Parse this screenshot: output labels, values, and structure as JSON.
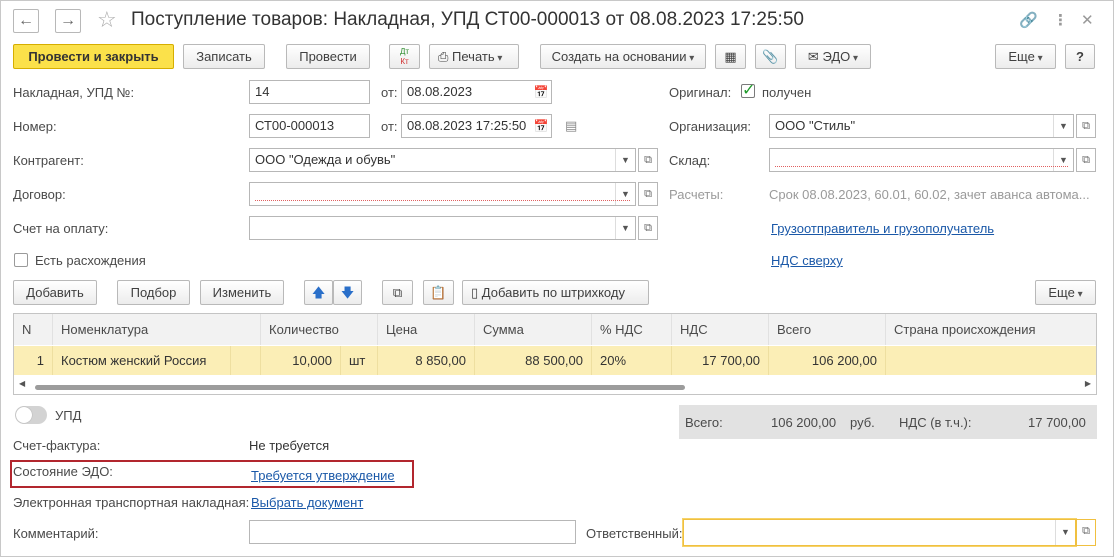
{
  "window": {
    "title": "Поступление товаров: Накладная, УПД СТ00-000013 от 08.08.2023 17:25:50"
  },
  "toolbar": {
    "post_close": "Провести и закрыть",
    "save": "Записать",
    "post": "Провести",
    "dtkt_dt": "Дт",
    "dtkt_kt": "Кт",
    "print": "Печать",
    "create_based": "Создать на основании",
    "edo": "ЭДО",
    "more": "Еще",
    "help": "?"
  },
  "form": {
    "invoice_label": "Накладная, УПД №:",
    "invoice_value": "14",
    "from_label": "от:",
    "invoice_date": "08.08.2023",
    "number_label": "Номер:",
    "number_value": "СТ00-000013",
    "number_date": "08.08.2023 17:25:50",
    "counterparty_label": "Контрагент:",
    "counterparty_value": "ООО \"Одежда и обувь\"",
    "contract_label": "Договор:",
    "contract_value": "",
    "payment_label": "Счет на оплату:",
    "payment_value": "",
    "discrepancies_label": "Есть расхождения",
    "original_label": "Оригинал:",
    "original_value": "получен",
    "org_label": "Организация:",
    "org_value": "ООО \"Стиль\"",
    "warehouse_label": "Склад:",
    "warehouse_value": "",
    "settlements_label": "Расчеты:",
    "settlements_value": "Срок 08.08.2023, 60.01, 60.02, зачет аванса автома...",
    "shipper_link": "Грузоотправитель и грузополучатель",
    "vat_link": "НДС сверху"
  },
  "table_toolbar": {
    "add": "Добавить",
    "pick": "Подбор",
    "change": "Изменить",
    "barcode": "Добавить по штрихкоду",
    "more": "Еще"
  },
  "table": {
    "headers": [
      "N",
      "Номенклатура",
      "Количество",
      "Цена",
      "Сумма",
      "% НДС",
      "НДС",
      "Всего",
      "Страна происхождения"
    ],
    "rows": [
      {
        "n": "1",
        "item": "Костюм женский Россия",
        "qty": "10,000",
        "unit": "шт",
        "price": "8 850,00",
        "sum": "88 500,00",
        "vat_rate": "20%",
        "vat": "17 700,00",
        "total": "106 200,00",
        "country": ""
      }
    ]
  },
  "bottom": {
    "upd_label": "УПД",
    "total_label": "Всего:",
    "total_value": "106 200,00",
    "currency": "руб.",
    "vat_incl_label": "НДС (в т.ч.):",
    "vat_incl_value": "17 700,00",
    "invoice_doc_label": "Счет-фактура:",
    "invoice_doc_value": "Не требуется",
    "edo_state_label": "Состояние ЭДО:",
    "edo_state_value": "Требуется утверждение",
    "etn_label": "Электронная транспортная накладная:",
    "etn_value": "Выбрать документ",
    "comment_label": "Комментарий:",
    "comment_value": "",
    "responsible_label": "Ответственный:",
    "responsible_value": ""
  }
}
